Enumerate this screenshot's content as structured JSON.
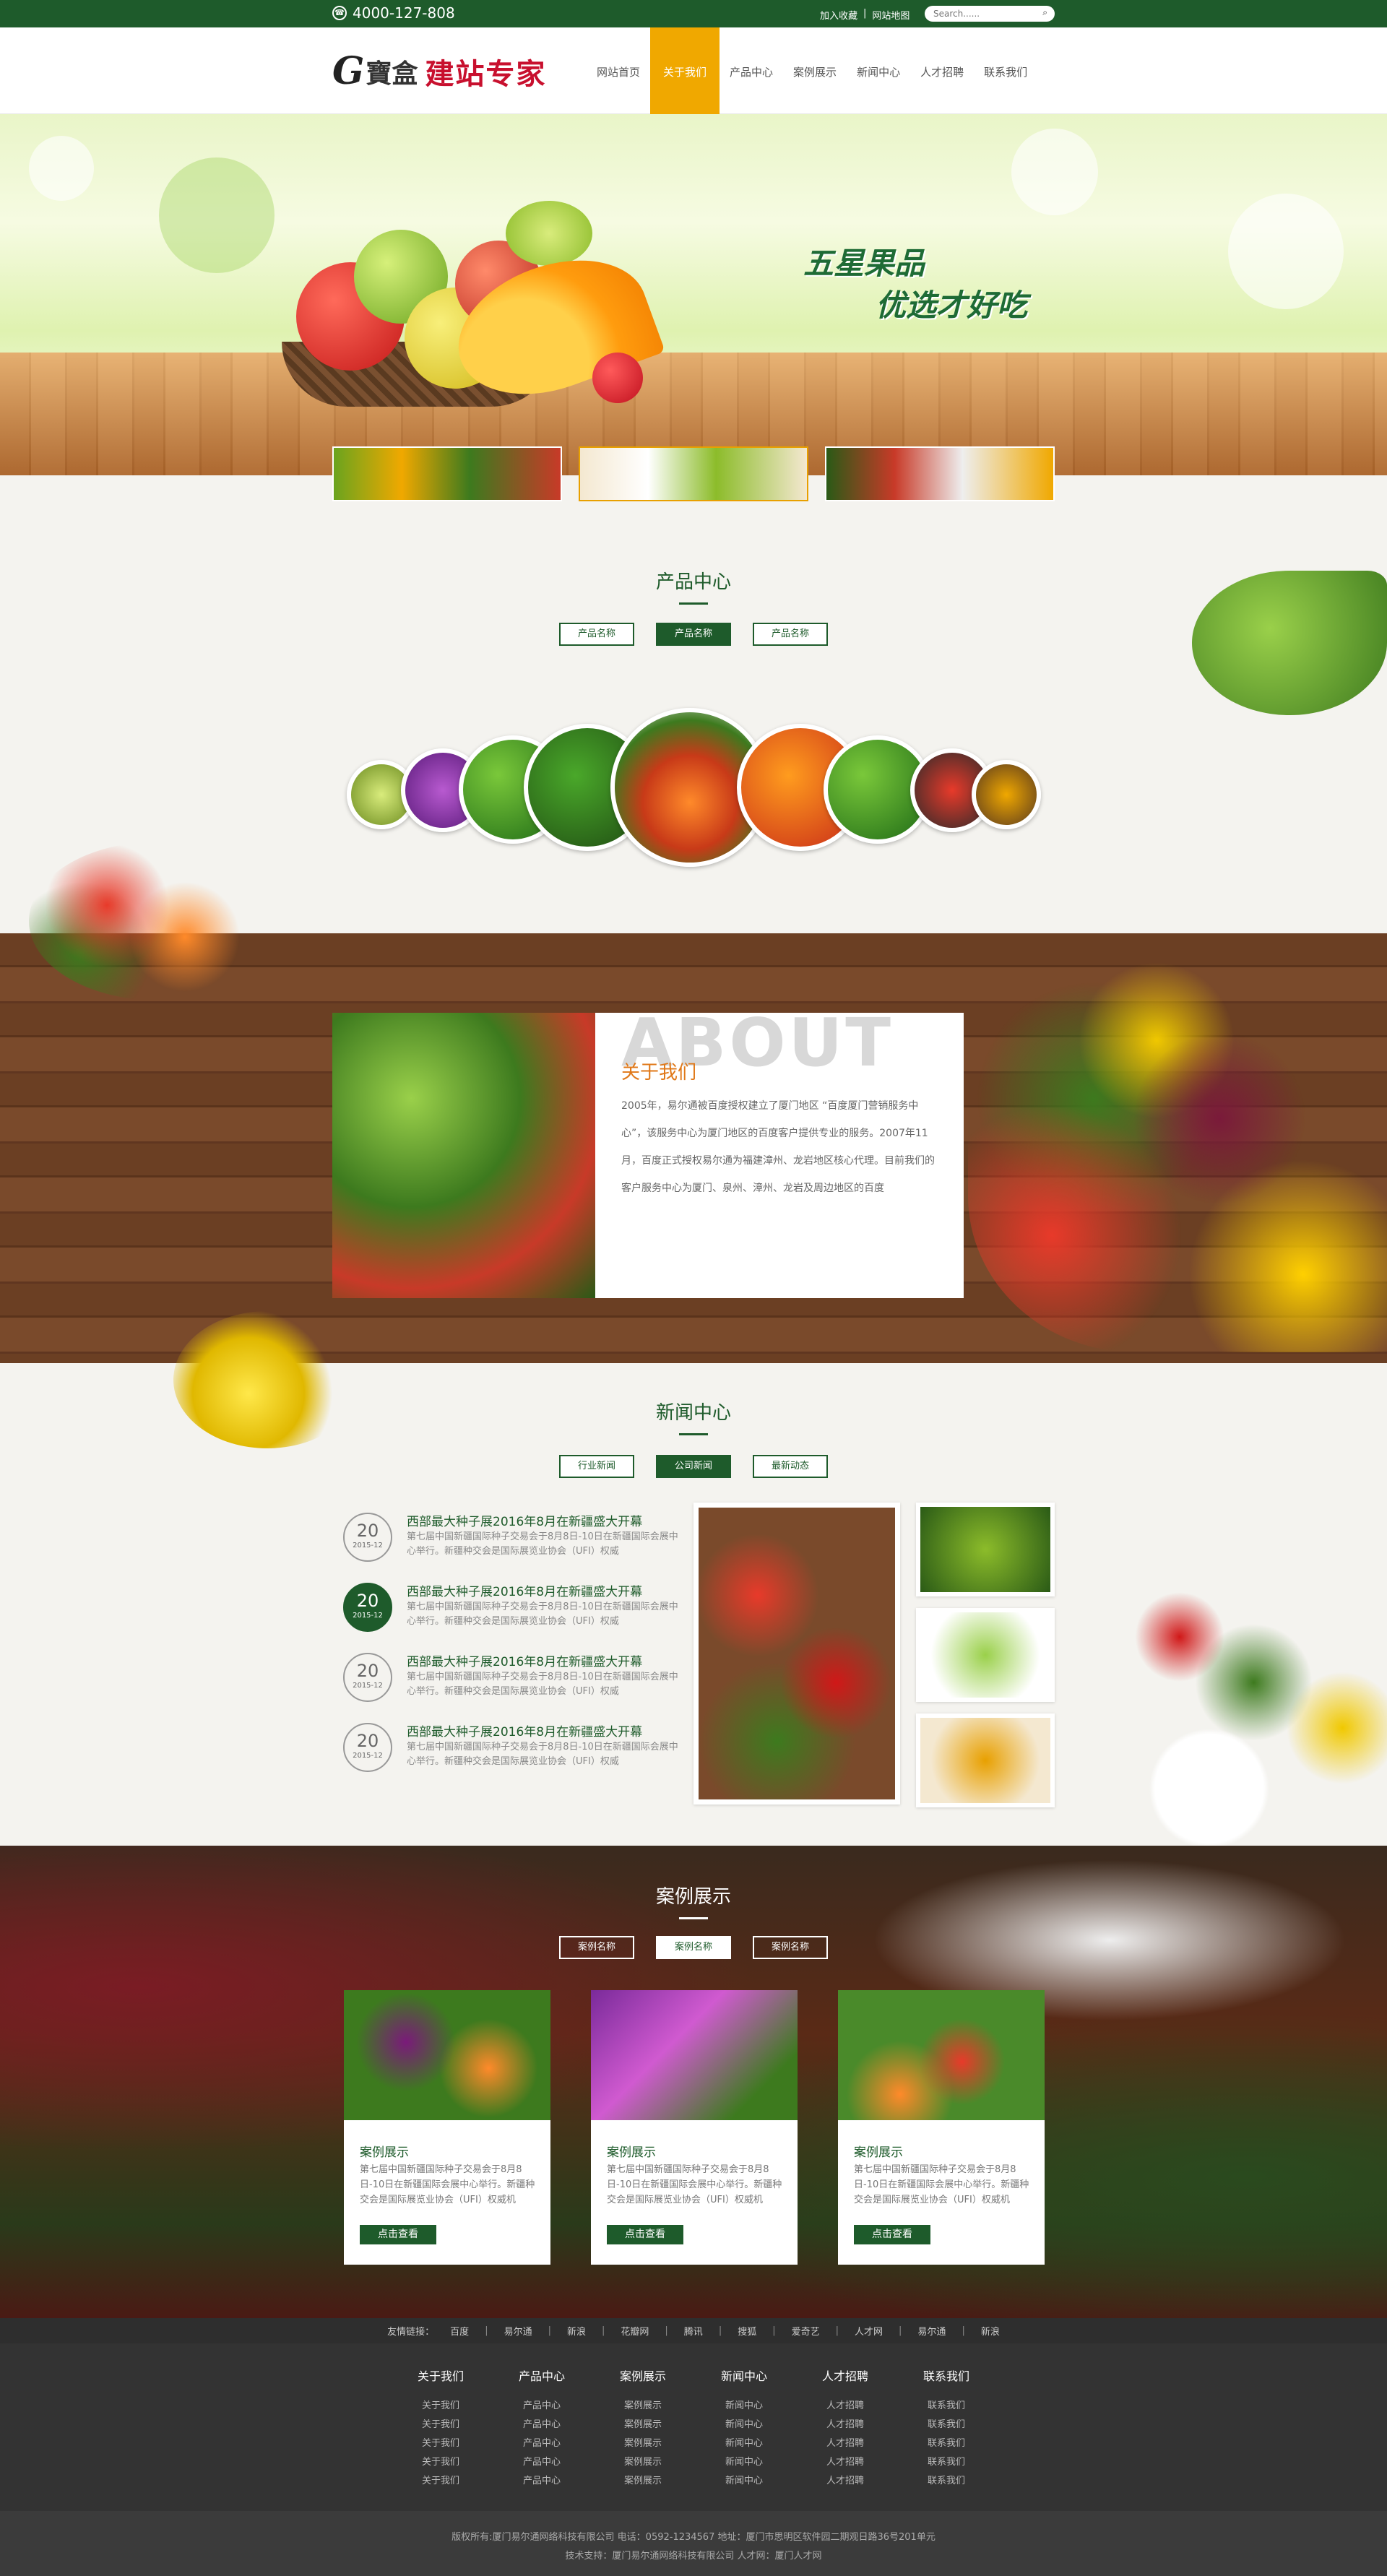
{
  "topbar": {
    "phone": "4000-127-808",
    "links": [
      "加入收藏",
      "网站地图"
    ],
    "search_placeholder": "Search......"
  },
  "logo": {
    "g": "G",
    "name": "寶盒",
    "tag": "建站专家"
  },
  "nav": [
    "网站首页",
    "关于我们",
    "产品中心",
    "案例展示",
    "新闻中心",
    "人才招聘",
    "联系我们"
  ],
  "banner": {
    "line1": "五星果品",
    "line2": "优选才好吃"
  },
  "products": {
    "title": "产品中心",
    "tabs": [
      "产品名称",
      "产品名称",
      "产品名称"
    ]
  },
  "about": {
    "big": "ABOUT",
    "title": "关于我们",
    "text": "2005年，易尔通被百度授权建立了厦门地区 “百度厦门营销服务中心”，该服务中心为厦门地区的百度客户提供专业的服务。2007年11月，百度正式授权易尔通为福建漳州、龙岩地区核心代理。目前我们的客户服务中心为厦门、泉州、漳州、龙岩及周边地区的百度"
  },
  "news": {
    "title": "新闻中心",
    "tabs": [
      "行业新闻",
      "公司新闻",
      "最新动态"
    ],
    "items": [
      {
        "day": "20",
        "ym": "2015-12",
        "title": "西部最大种子展2016年8月在新疆盛大开幕",
        "desc": "第七届中国新疆国际种子交易会于8月8日-10日在新疆国际会展中心举行。新疆种交会是国际展览业协会（UFI）权威"
      },
      {
        "day": "20",
        "ym": "2015-12",
        "title": "西部最大种子展2016年8月在新疆盛大开幕",
        "desc": "第七届中国新疆国际种子交易会于8月8日-10日在新疆国际会展中心举行。新疆种交会是国际展览业协会（UFI）权威"
      },
      {
        "day": "20",
        "ym": "2015-12",
        "title": "西部最大种子展2016年8月在新疆盛大开幕",
        "desc": "第七届中国新疆国际种子交易会于8月8日-10日在新疆国际会展中心举行。新疆种交会是国际展览业协会（UFI）权威"
      },
      {
        "day": "20",
        "ym": "2015-12",
        "title": "西部最大种子展2016年8月在新疆盛大开幕",
        "desc": "第七届中国新疆国际种子交易会于8月8日-10日在新疆国际会展中心举行。新疆种交会是国际展览业协会（UFI）权威"
      }
    ]
  },
  "cases": {
    "title": "案例展示",
    "tabs": [
      "案例名称",
      "案例名称",
      "案例名称"
    ],
    "cards": [
      {
        "title": "案例展示",
        "desc": "第七届中国新疆国际种子交易会于8月8日-10日在新疆国际会展中心举行。新疆种交会是国际展览业协会（UFI）权威机",
        "btn": "点击查看"
      },
      {
        "title": "案例展示",
        "desc": "第七届中国新疆国际种子交易会于8月8日-10日在新疆国际会展中心举行。新疆种交会是国际展览业协会（UFI）权威机",
        "btn": "点击查看"
      },
      {
        "title": "案例展示",
        "desc": "第七届中国新疆国际种子交易会于8月8日-10日在新疆国际会展中心举行。新疆种交会是国际展览业协会（UFI）权威机",
        "btn": "点击查看"
      }
    ]
  },
  "friend": {
    "label": "友情链接：",
    "links": [
      "百度",
      "易尔通",
      "新浪",
      "花瓣网",
      "腾讯",
      "搜狐",
      "爱奇艺",
      "人才网",
      "易尔通",
      "新浪"
    ]
  },
  "footer": {
    "cols": [
      {
        "title": "关于我们",
        "items": [
          "关于我们",
          "关于我们",
          "关于我们",
          "关于我们",
          "关于我们"
        ]
      },
      {
        "title": "产品中心",
        "items": [
          "产品中心",
          "产品中心",
          "产品中心",
          "产品中心",
          "产品中心"
        ]
      },
      {
        "title": "案例展示",
        "items": [
          "案例展示",
          "案例展示",
          "案例展示",
          "案例展示",
          "案例展示"
        ]
      },
      {
        "title": "新闻中心",
        "items": [
          "新闻中心",
          "新闻中心",
          "新闻中心",
          "新闻中心",
          "新闻中心"
        ]
      },
      {
        "title": "人才招聘",
        "items": [
          "人才招聘",
          "人才招聘",
          "人才招聘",
          "人才招聘",
          "人才招聘"
        ]
      },
      {
        "title": "联系我们",
        "items": [
          "联系我们",
          "联系我们",
          "联系我们",
          "联系我们",
          "联系我们"
        ]
      }
    ],
    "copy1": "版权所有:厦门易尔通网络科技有限公司 电话：0592-1234567 地址：厦门市思明区软件园二期观日路36号201单元",
    "copy2": "技术支持：厦门易尔通网络科技有限公司 人才网：厦门人才网"
  },
  "colors": {
    "brand": "#1e5b2b",
    "accent": "#f0a800",
    "about_title": "#e07818"
  }
}
